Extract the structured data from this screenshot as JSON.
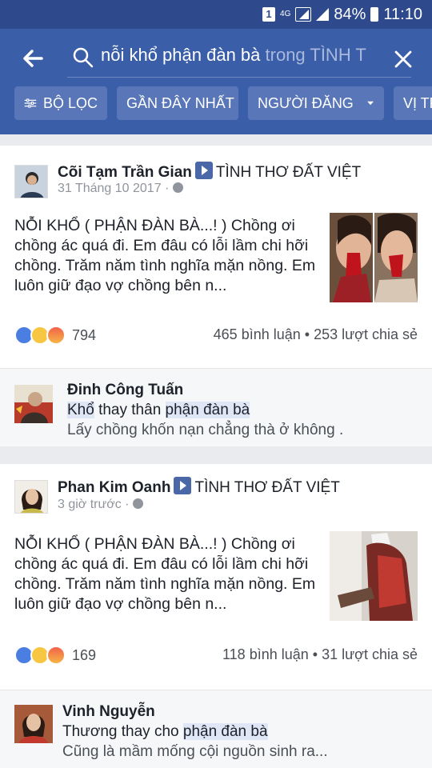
{
  "status_bar": {
    "sim_badge": "1",
    "network": "4G",
    "battery": "84%",
    "time": "11:10"
  },
  "search": {
    "query": "nỗi khổ phận đàn bà",
    "scope": " trong TÌNH T"
  },
  "filters": [
    {
      "label": "BỘ LỌC",
      "icon": "filter-sliders-icon"
    },
    {
      "label": "GẦN ĐÂY NHẤT"
    },
    {
      "label": "NGƯỜI ĐĂNG",
      "icon": "chevron-down-icon"
    },
    {
      "label": "VỊ TR"
    }
  ],
  "posts": [
    {
      "author": "Cõi Tạm Trần Gian",
      "group": "TÌNH THƠ ĐẤT VIỆT",
      "date": "31 Tháng 10 2017 ·",
      "text": "NỖI KHỔ ( PHẬN ĐÀN BÀ...! ) Chồng ơi chồng ác quá đi. Em đâu có lỗi lầm chi hỡi chồng. Trăm năm tình nghĩa mặn nồng. Em luôn giữ đạo vợ chồng bên n...",
      "reaction_count": "794",
      "comments": "465 bình luận",
      "shares": "253 lượt chia sẻ",
      "top_comment": {
        "name": "Đinh Công Tuấn",
        "line1_pre": "",
        "line1_hl1": "Khổ",
        "line1_mid": " thay thân ",
        "line1_hl2": "phận đàn bà",
        "line2": "Lấy chồng khốn nạn chẳng thà ở không ."
      }
    },
    {
      "author": "Phan Kim Oanh",
      "group": "TÌNH THƠ ĐẤT VIỆT",
      "date": "3 giờ trước ·",
      "text": "NỖI KHỔ ( PHẬN ĐÀN BÀ...! ) Chồng ơi chồng ác quá đi. Em đâu có lỗi lầm chi hỡi chồng. Trăm năm tình nghĩa mặn nồng. Em luôn giữ đạo vợ chồng bên n...",
      "reaction_count": "169",
      "comments": "118 bình luận",
      "shares": "31 lượt chia sẻ",
      "top_comment": {
        "name": "Vinh Nguyễn",
        "line1_pre": "Thương thay cho ",
        "line1_hl": "phận đàn bà",
        "line2": "Cũng là mầm mống cội nguồn sinh ra..."
      }
    }
  ],
  "stat_separator": " • "
}
